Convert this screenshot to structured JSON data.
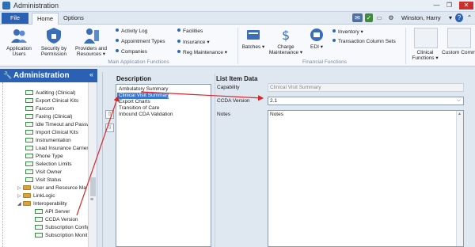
{
  "window": {
    "title": "Administration",
    "min": "—",
    "max": "❐",
    "close": "✕"
  },
  "tabs": {
    "file": "File",
    "home": "Home",
    "options": "Options"
  },
  "topbar": {
    "user": "Winston, Harry",
    "user_dropdown": "▾",
    "help": "?",
    "settings": "⚙"
  },
  "ribbon": {
    "main_group_label": "Main Application Functions",
    "financial_group_label": "Financial Functions",
    "application_users": "Application Users",
    "security_by_permission": "Security by Permission",
    "providers_and_resources": "Providers and Resources ▾",
    "activity_log": "Activity Log",
    "appointment_types": "Appointment Types",
    "companies": "Companies",
    "facilities": "Facilities",
    "insurance": "Insurance ▾",
    "reg_maintenance": "Reg Maintenance ▾",
    "batches": "Batches ▾",
    "charge_maintenance": "Charge Maintenance ▾",
    "edi": "EDI ▾",
    "inventory": "Inventory ▾",
    "transaction_column_sets": "Transaction Column Sets",
    "clinical_functions": "Clinical Functions ▾",
    "custom_commands": "Custom Command"
  },
  "left_pane": {
    "title": "Administration",
    "collapse": "«",
    "items": [
      {
        "label": "Auditing (Clinical)"
      },
      {
        "label": "Export Clinical Kits"
      },
      {
        "label": "Faxcom"
      },
      {
        "label": "Faxing (Clinical)"
      },
      {
        "label": "Idle Timeout and Passw"
      },
      {
        "label": "Import Clinical Kits"
      },
      {
        "label": "Instrumentation"
      },
      {
        "label": "Load Insurance Carrier"
      },
      {
        "label": "Phone Type"
      },
      {
        "label": "Selection Limits"
      },
      {
        "label": "Visit Owner"
      },
      {
        "label": "Visit Status"
      },
      {
        "label": "User and Resource Ma"
      },
      {
        "label": "LinkLogic"
      },
      {
        "label": "Interoperability"
      },
      {
        "label": "API Server"
      },
      {
        "label": "CCDA Version"
      },
      {
        "label": "Subscription Config"
      },
      {
        "label": "Subscription Monit"
      }
    ]
  },
  "description": {
    "title": "Description",
    "items": [
      "Ambulatory Summary",
      "Clinical Visit Summary",
      "Export Charts",
      "Transition of Care",
      "Inbound CDA Validation"
    ],
    "up": "⇧",
    "down": "⇩"
  },
  "list_item_data": {
    "title": "List Item Data",
    "capability_label": "Capability",
    "capability_value": "Clinical Visit Summary",
    "ccda_version_label": "CCDA Version",
    "ccda_version_value": "2.1",
    "notes_label": "Notes",
    "notes_value": "Notes"
  },
  "colors": {
    "accent": "#2b61b5",
    "selection": "#3a78d0",
    "annotation": "#d9262b"
  }
}
